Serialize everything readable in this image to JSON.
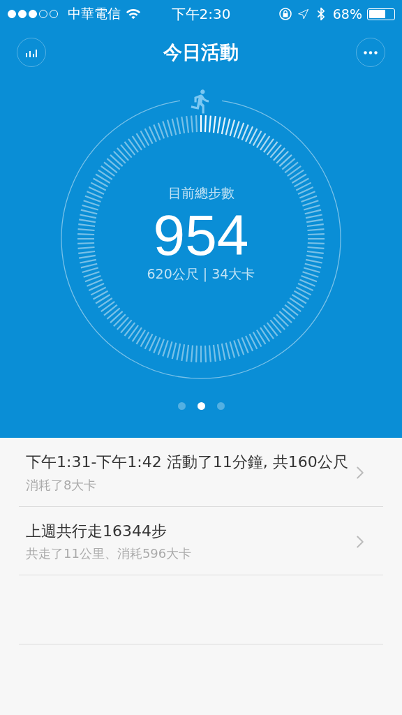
{
  "status_bar": {
    "carrier": "中華電信",
    "time": "下午2:30",
    "battery": "68%"
  },
  "header": {
    "title": "今日活動"
  },
  "ring": {
    "label": "目前總步數",
    "steps": "954",
    "summary": "620公尺 | 34大卡"
  },
  "pages": [
    {
      "selected": false
    },
    {
      "selected": true
    },
    {
      "selected": false
    }
  ],
  "entries": [
    {
      "title": "下午1:31-下午1:42 活動了11分鐘, 共160公尺",
      "subtitle": "消耗了8大卡"
    },
    {
      "title": "上週共行走16344步",
      "subtitle": "共走了11公里、消耗596大卡"
    }
  ]
}
